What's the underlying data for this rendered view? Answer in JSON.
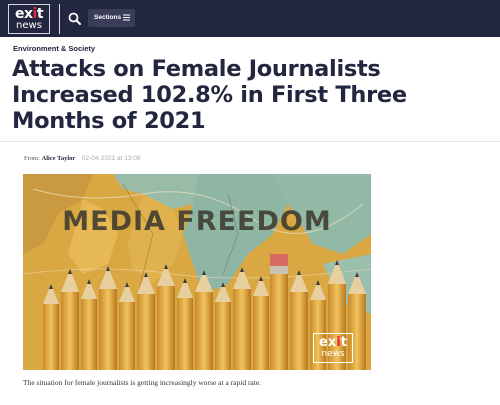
{
  "header": {
    "logo": {
      "word": "exit",
      "sub": "news"
    },
    "sections_label": "Sections"
  },
  "article": {
    "category": "Environment & Society",
    "title": "Attacks on Female Journalists Increased 102.8% in First Three Months of 2021",
    "byline_prefix": "From:",
    "author": "Alice Taylor",
    "date": "02-04-2021 at 13:08",
    "image": {
      "overlay_text": "MEDIA FREEDOM",
      "logo": {
        "word": "exit",
        "sub": "news"
      }
    },
    "caption": "The situation for female journalists is getting increasingly worse at a rapid rate."
  },
  "colors": {
    "nav_bg": "#23263f",
    "accent": "#e02b34",
    "headline": "#23263f"
  }
}
